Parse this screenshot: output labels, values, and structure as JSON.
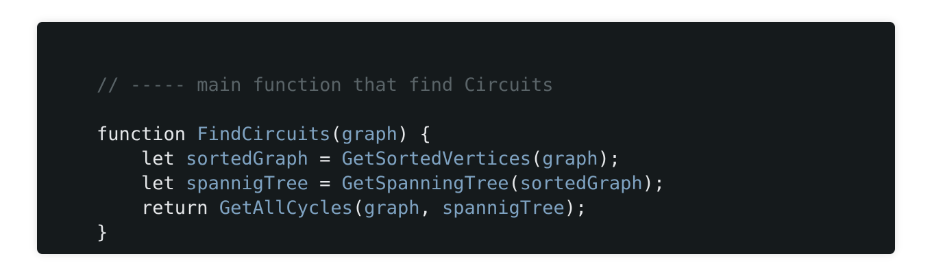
{
  "colors": {
    "background": "#151a1c",
    "default_text": "#e6e8ea",
    "identifier": "#7fa3c2",
    "comment": "#5a6468"
  },
  "code": {
    "lines": [
      [
        {
          "t": "comment",
          "text": "// ----- main function that find Circuits"
        }
      ],
      [],
      [
        {
          "t": "keyword",
          "text": "function"
        },
        {
          "t": "punct",
          "text": " "
        },
        {
          "t": "ident",
          "text": "FindCircuits"
        },
        {
          "t": "punct",
          "text": "("
        },
        {
          "t": "ident",
          "text": "graph"
        },
        {
          "t": "punct",
          "text": ") {"
        }
      ],
      [
        {
          "t": "punct",
          "text": "    "
        },
        {
          "t": "keyword",
          "text": "let"
        },
        {
          "t": "punct",
          "text": " "
        },
        {
          "t": "ident",
          "text": "sortedGraph"
        },
        {
          "t": "punct",
          "text": " = "
        },
        {
          "t": "ident",
          "text": "GetSortedVertices"
        },
        {
          "t": "punct",
          "text": "("
        },
        {
          "t": "ident",
          "text": "graph"
        },
        {
          "t": "punct",
          "text": ");"
        }
      ],
      [
        {
          "t": "punct",
          "text": "    "
        },
        {
          "t": "keyword",
          "text": "let"
        },
        {
          "t": "punct",
          "text": " "
        },
        {
          "t": "ident",
          "text": "spannigTree"
        },
        {
          "t": "punct",
          "text": " = "
        },
        {
          "t": "ident",
          "text": "GetSpanningTree"
        },
        {
          "t": "punct",
          "text": "("
        },
        {
          "t": "ident",
          "text": "sortedGraph"
        },
        {
          "t": "punct",
          "text": ");"
        }
      ],
      [
        {
          "t": "punct",
          "text": "    "
        },
        {
          "t": "keyword",
          "text": "return"
        },
        {
          "t": "punct",
          "text": " "
        },
        {
          "t": "ident",
          "text": "GetAllCycles"
        },
        {
          "t": "punct",
          "text": "("
        },
        {
          "t": "ident",
          "text": "graph"
        },
        {
          "t": "punct",
          "text": ", "
        },
        {
          "t": "ident",
          "text": "spannigTree"
        },
        {
          "t": "punct",
          "text": ");"
        }
      ],
      [
        {
          "t": "punct",
          "text": "}"
        }
      ]
    ]
  }
}
